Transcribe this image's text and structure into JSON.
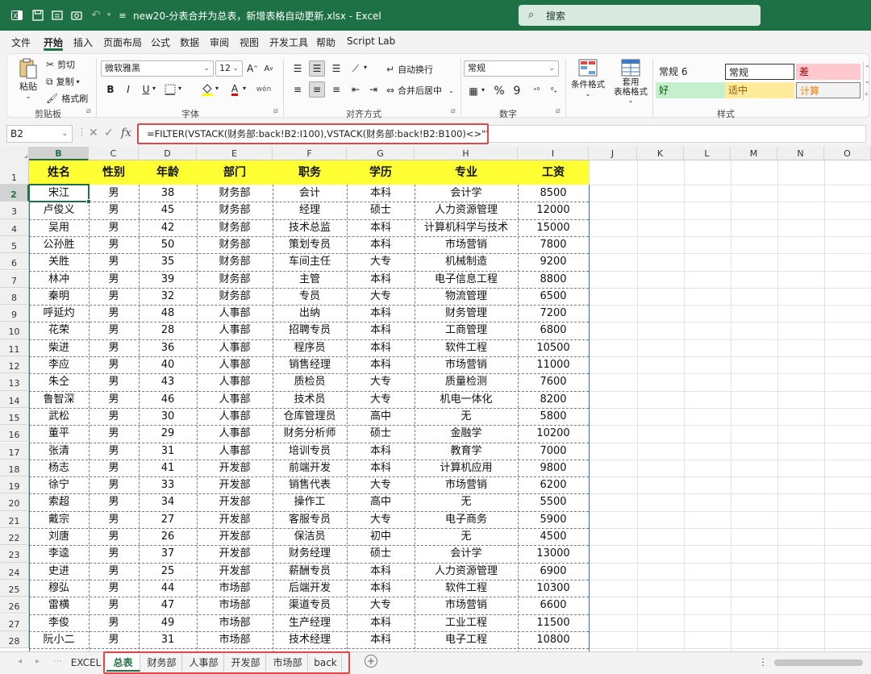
{
  "titlebar": {
    "filename": "new20-分表合并为总表，新增表格自动更新.xlsx  -  Excel",
    "search": "搜索"
  },
  "menu": [
    "文件",
    "开始",
    "插入",
    "页面布局",
    "公式",
    "数据",
    "审阅",
    "视图",
    "开发工具",
    "帮助",
    "Script Lab"
  ],
  "ribbon": {
    "clipboard": {
      "paste": "粘贴",
      "cut": "剪切",
      "copy": "复制",
      "format_painter": "格式刷",
      "group": "剪贴板"
    },
    "font": {
      "name": "微软雅黑",
      "size": "12",
      "grow": "A",
      "shrink": "A",
      "bold": "B",
      "italic": "I",
      "underline": "U",
      "font_color": "A",
      "wen": "wén",
      "group": "字体"
    },
    "align": {
      "wrap": "自动换行",
      "merge": "合并后居中",
      "group": "对齐方式"
    },
    "number": {
      "format": "常规",
      "pct": "%",
      "comma": "9",
      "group": "数字"
    },
    "cond_format": "条件格式",
    "table_format": "套用\n表格格式",
    "styles": {
      "normal6": "常规 6",
      "normal": "常规",
      "bad": "差",
      "good": "好",
      "neutral": "适中",
      "calc": "计算",
      "group": "样式"
    }
  },
  "formula_bar": {
    "name_box": "B2",
    "formula": "=FILTER(VSTACK(财务部:back!B2:I100),VSTACK(财务部:back!B2:B100)<>\"\",\"\")"
  },
  "columns": [
    "B",
    "C",
    "D",
    "E",
    "F",
    "G",
    "H",
    "I",
    "J",
    "K",
    "L",
    "M",
    "N",
    "O"
  ],
  "rows": [
    "1",
    "2",
    "3",
    "4",
    "5",
    "6",
    "7",
    "8",
    "9",
    "10",
    "11",
    "12",
    "13",
    "14",
    "15",
    "16",
    "17",
    "18",
    "19",
    "20",
    "21",
    "22",
    "23",
    "24",
    "25",
    "26",
    "27",
    "28"
  ],
  "table": {
    "headers": [
      "姓名",
      "性别",
      "年龄",
      "部门",
      "职务",
      "学历",
      "专业",
      "工资"
    ],
    "rows": [
      [
        "宋江",
        "男",
        "38",
        "财务部",
        "会计",
        "本科",
        "会计学",
        "8500"
      ],
      [
        "卢俊义",
        "男",
        "45",
        "财务部",
        "经理",
        "硕士",
        "人力资源管理",
        "12000"
      ],
      [
        "吴用",
        "男",
        "42",
        "财务部",
        "技术总监",
        "本科",
        "计算机科学与技术",
        "15000"
      ],
      [
        "公孙胜",
        "男",
        "50",
        "财务部",
        "策划专员",
        "本科",
        "市场营销",
        "7800"
      ],
      [
        "关胜",
        "男",
        "35",
        "财务部",
        "车间主任",
        "大专",
        "机械制造",
        "9200"
      ],
      [
        "林冲",
        "男",
        "39",
        "财务部",
        "主管",
        "本科",
        "电子信息工程",
        "8800"
      ],
      [
        "秦明",
        "男",
        "32",
        "财务部",
        "专员",
        "大专",
        "物流管理",
        "6500"
      ],
      [
        "呼延灼",
        "男",
        "48",
        "人事部",
        "出纳",
        "本科",
        "财务管理",
        "7200"
      ],
      [
        "花荣",
        "男",
        "28",
        "人事部",
        "招聘专员",
        "本科",
        "工商管理",
        "6800"
      ],
      [
        "柴进",
        "男",
        "36",
        "人事部",
        "程序员",
        "本科",
        "软件工程",
        "10500"
      ],
      [
        "李应",
        "男",
        "40",
        "人事部",
        "销售经理",
        "本科",
        "市场营销",
        "11000"
      ],
      [
        "朱仝",
        "男",
        "43",
        "人事部",
        "质检员",
        "大专",
        "质量检测",
        "7600"
      ],
      [
        "鲁智深",
        "男",
        "46",
        "人事部",
        "技术员",
        "大专",
        "机电一体化",
        "8200"
      ],
      [
        "武松",
        "男",
        "30",
        "人事部",
        "仓库管理员",
        "高中",
        "无",
        "5800"
      ],
      [
        "董平",
        "男",
        "29",
        "人事部",
        "财务分析师",
        "硕士",
        "金融学",
        "10200"
      ],
      [
        "张清",
        "男",
        "31",
        "人事部",
        "培训专员",
        "本科",
        "教育学",
        "7000"
      ],
      [
        "杨志",
        "男",
        "41",
        "开发部",
        "前端开发",
        "本科",
        "计算机应用",
        "9800"
      ],
      [
        "徐宁",
        "男",
        "33",
        "开发部",
        "销售代表",
        "大专",
        "市场营销",
        "6200"
      ],
      [
        "索超",
        "男",
        "34",
        "开发部",
        "操作工",
        "高中",
        "无",
        "5500"
      ],
      [
        "戴宗",
        "男",
        "27",
        "开发部",
        "客服专员",
        "大专",
        "电子商务",
        "5900"
      ],
      [
        "刘唐",
        "男",
        "26",
        "开发部",
        "保洁员",
        "初中",
        "无",
        "4500"
      ],
      [
        "李逵",
        "男",
        "37",
        "开发部",
        "财务经理",
        "硕士",
        "会计学",
        "13000"
      ],
      [
        "史进",
        "男",
        "25",
        "开发部",
        "薪酬专员",
        "本科",
        "人力资源管理",
        "6900"
      ],
      [
        "穆弘",
        "男",
        "44",
        "市场部",
        "后端开发",
        "本科",
        "软件工程",
        "10300"
      ],
      [
        "雷横",
        "男",
        "47",
        "市场部",
        "渠道专员",
        "大专",
        "市场营销",
        "6600"
      ],
      [
        "李俊",
        "男",
        "49",
        "市场部",
        "生产经理",
        "本科",
        "工业工程",
        "11500"
      ],
      [
        "阮小二",
        "男",
        "31",
        "市场部",
        "技术经理",
        "本科",
        "电子工程",
        "10800"
      ]
    ]
  },
  "sheets": [
    "EXCEL",
    "总表",
    "财务部",
    "人事部",
    "开发部",
    "市场部",
    "back"
  ],
  "active_sheet": "总表",
  "colors": {
    "brand": "#1e7145",
    "header_fill": "#ffff33",
    "highlight_box": "#e04848"
  }
}
